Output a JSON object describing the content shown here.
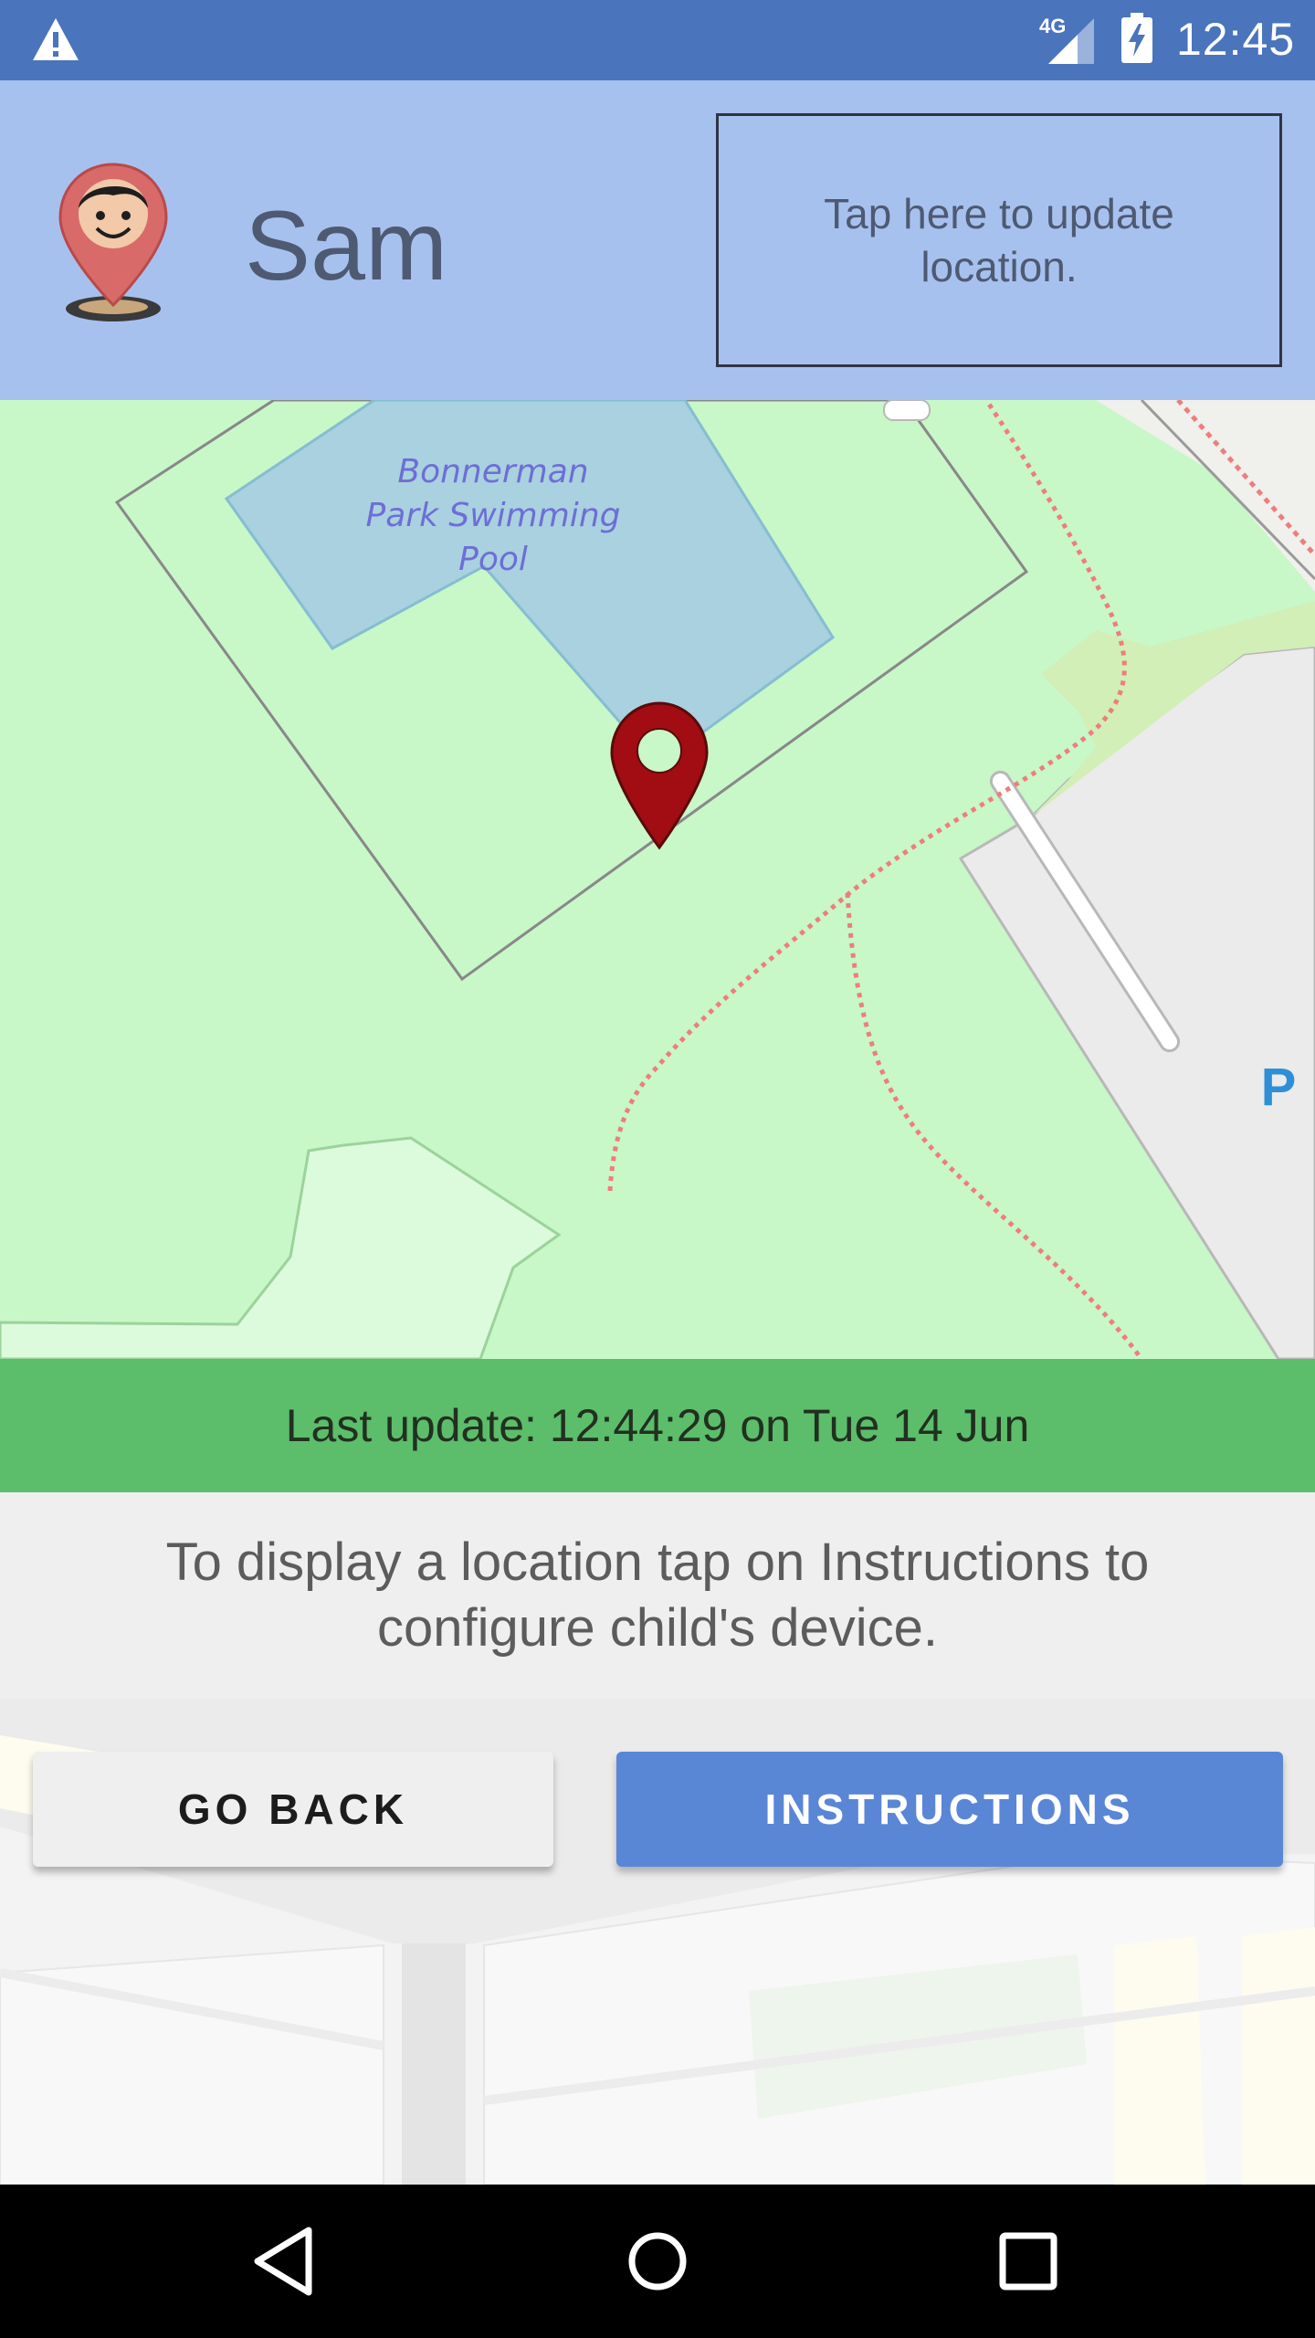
{
  "status_bar": {
    "time": "12:45",
    "network": "4G",
    "icons": [
      "warning-icon",
      "signal-icon",
      "battery-charging-icon"
    ]
  },
  "header": {
    "child_name": "Sam",
    "update_button_label": "Tap here to update location.",
    "avatar_icon": "child-location-pin-icon"
  },
  "map": {
    "poi_label": "Bonnerman Park Swimming Pool",
    "parking_label": "P",
    "marker_icon": "map-pin-icon",
    "colors": {
      "park": "#c8f7c8",
      "water": "#a9d1df",
      "path": "#ee7d7d",
      "building": "#ececec",
      "marker": "#a10d12"
    }
  },
  "last_update": {
    "text": "Last update: 12:44:29 on Tue 14 Jun",
    "color": "#5cbd6b"
  },
  "message": {
    "text": "To display a location tap on Instructions to configure child's device."
  },
  "buttons": {
    "back_label": "GO BACK",
    "instructions_label": "INSTRUCTIONS",
    "instructions_color": "#5a86d6"
  },
  "nav_bar": {
    "items": [
      "back-triangle-icon",
      "home-circle-icon",
      "recents-square-icon"
    ]
  }
}
